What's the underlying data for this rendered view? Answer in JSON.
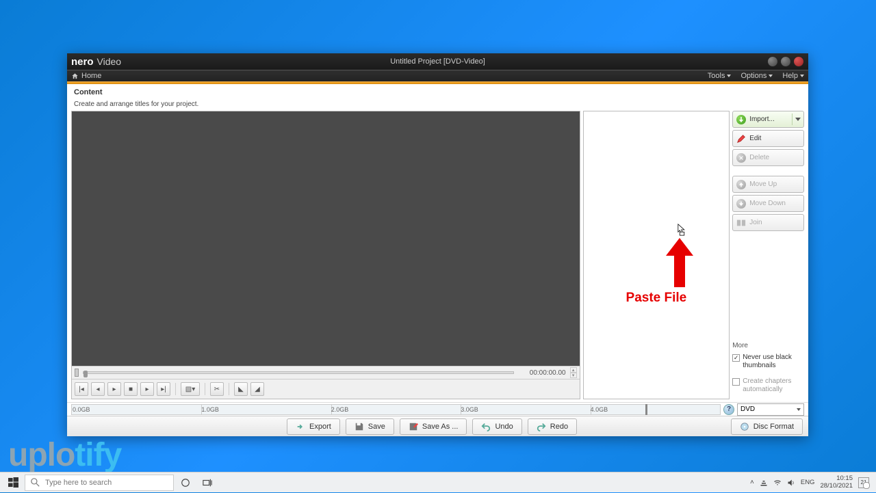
{
  "app": {
    "logo": "nero",
    "product": "Video",
    "project_title": "Untitled Project [DVD-Video]"
  },
  "menubar": {
    "home": "Home",
    "tools": "Tools",
    "options": "Options",
    "help": "Help"
  },
  "header": {
    "title": "Content",
    "subtitle": "Create and arrange titles for your project."
  },
  "timecode": "00:00:00.00",
  "actions": {
    "import": "Import...",
    "edit": "Edit",
    "delete": "Delete",
    "moveup": "Move Up",
    "movedown": "Move Down",
    "join": "Join"
  },
  "more": {
    "label": "More",
    "never_black": "Never use black thumbnails",
    "never_black_checked": true,
    "auto_chapters": "Create chapters automatically",
    "auto_chapters_checked": false
  },
  "sizebar": {
    "ticks": [
      "0.0GB",
      "1.0GB",
      "2.0GB",
      "3.0GB",
      "4.0GB"
    ],
    "disc_selected": "DVD"
  },
  "footer": {
    "export": "Export",
    "save": "Save",
    "saveas": "Save As ...",
    "undo": "Undo",
    "redo": "Redo",
    "discformat": "Disc Format"
  },
  "annotation": "Paste File",
  "watermark": {
    "part1": "uplo",
    "part2": "tify"
  },
  "taskbar": {
    "search_placeholder": "Type here to search",
    "lang": "ENG",
    "time": "10:15",
    "date": "28/10/2021",
    "notif_count": "21"
  }
}
